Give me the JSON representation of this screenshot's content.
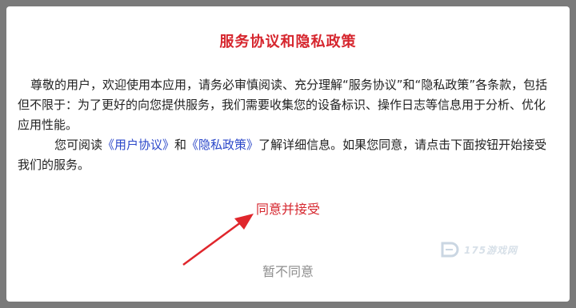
{
  "dialog": {
    "title": "服务协议和隐私政策",
    "paragraph1": "尊敬的用户，欢迎使用本应用，请务必审慎阅读、充分理解“服务协议”和“隐私政策”各条款，包括但不限于：为了更好的向您提供服务，我们需要收集您的设备标识、操作日志等信息用于分析、优化应用性能。",
    "paragraph2_prefix": "您可阅读",
    "user_agreement_link": "《用户协议》",
    "conjunction": "和",
    "privacy_policy_link": "《隐私政策》",
    "paragraph2_suffix": "了解详细信息。如果您同意，请点击下面按钮开始接受我们的服务。",
    "accept_button": "同意并接受",
    "decline_button": "暂不同意"
  },
  "watermark": {
    "text": "175游戏网"
  },
  "colors": {
    "accent_red": "#d6262e",
    "link_blue": "#2b47c9",
    "decline_gray": "#8e8e8e"
  },
  "icons": {
    "arrow": "annotation-arrow-icon",
    "watermark_logo": "watermark-logo-icon"
  }
}
